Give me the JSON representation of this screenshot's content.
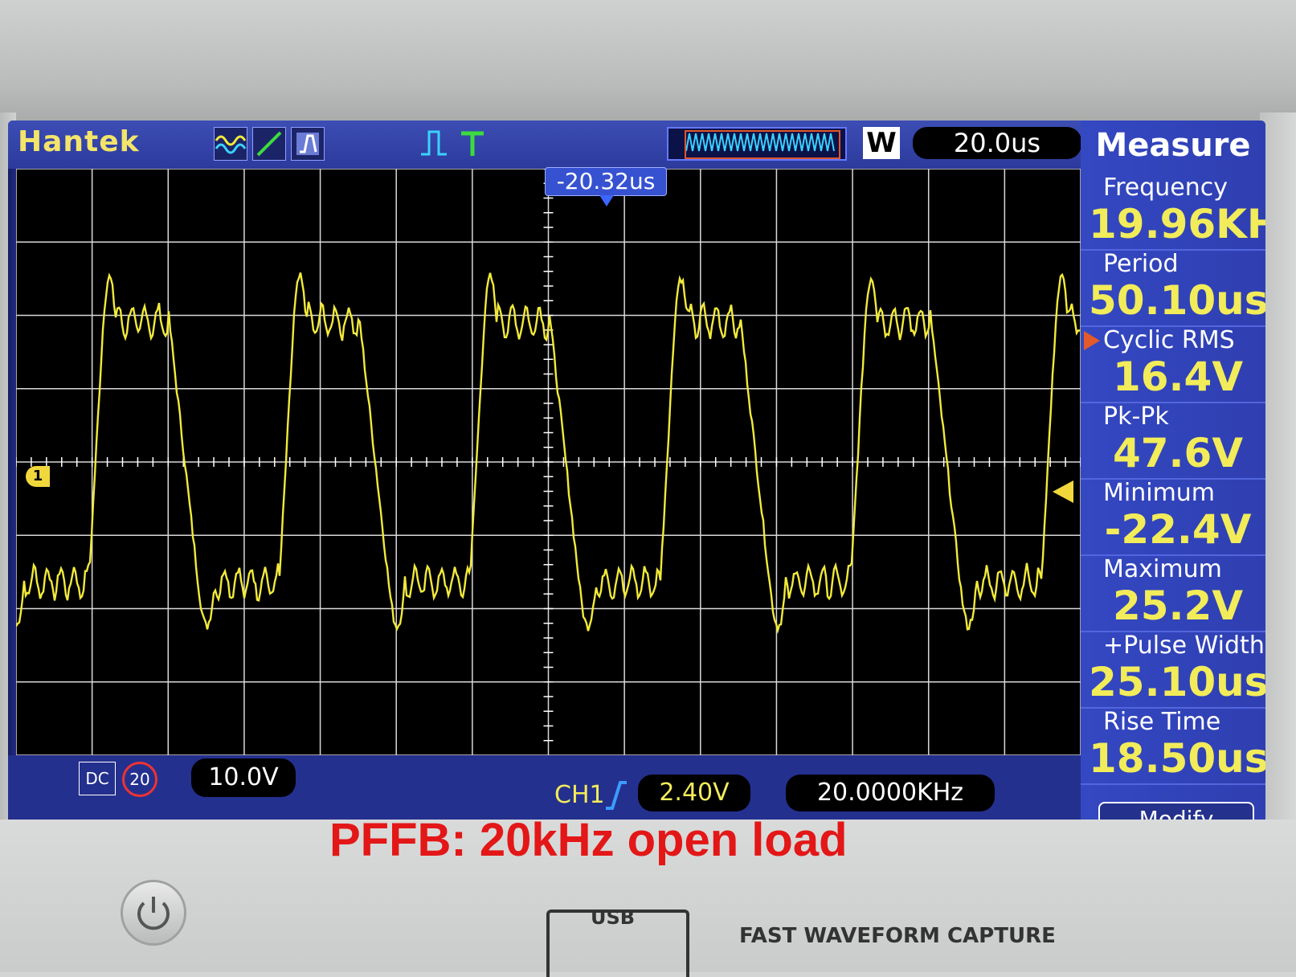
{
  "brand": "Hantek",
  "toolbar": {
    "timebase": "20.0us",
    "window_label": "W",
    "trigger_offset": "-20.32us"
  },
  "channel_marker": "1",
  "measure": {
    "title": "Measure",
    "items": [
      {
        "label": "Frequency",
        "value": "19.96KH"
      },
      {
        "label": "Period",
        "value": "50.10us"
      },
      {
        "label": "Cyclic RMS",
        "value": "16.4V"
      },
      {
        "label": "Pk-Pk",
        "value": "47.6V"
      },
      {
        "label": "Minimum",
        "value": "-22.4V"
      },
      {
        "label": "Maximum",
        "value": "25.2V"
      },
      {
        "label": "+Pulse Width",
        "value": "25.10us"
      },
      {
        "label": "Rise Time",
        "value": "18.50us"
      }
    ],
    "modify_label": "Modify"
  },
  "statusbar": {
    "coupling": "DC",
    "bw_limit": "20",
    "volts_div": "10.0V",
    "trigger_source": "CH1",
    "trigger_level": "2.40V",
    "trigger_frequency": "20.0000KHz"
  },
  "caption": "PFFB: 20kHz open load",
  "hardware": {
    "usb_label": "USB",
    "fast_capture_label": "FAST WAVEFORM CAPTURE"
  },
  "colors": {
    "trace": "#f2ea3a",
    "grid": "#ffffff",
    "caption": "#e31717",
    "panel": "#2f3fb1"
  }
}
